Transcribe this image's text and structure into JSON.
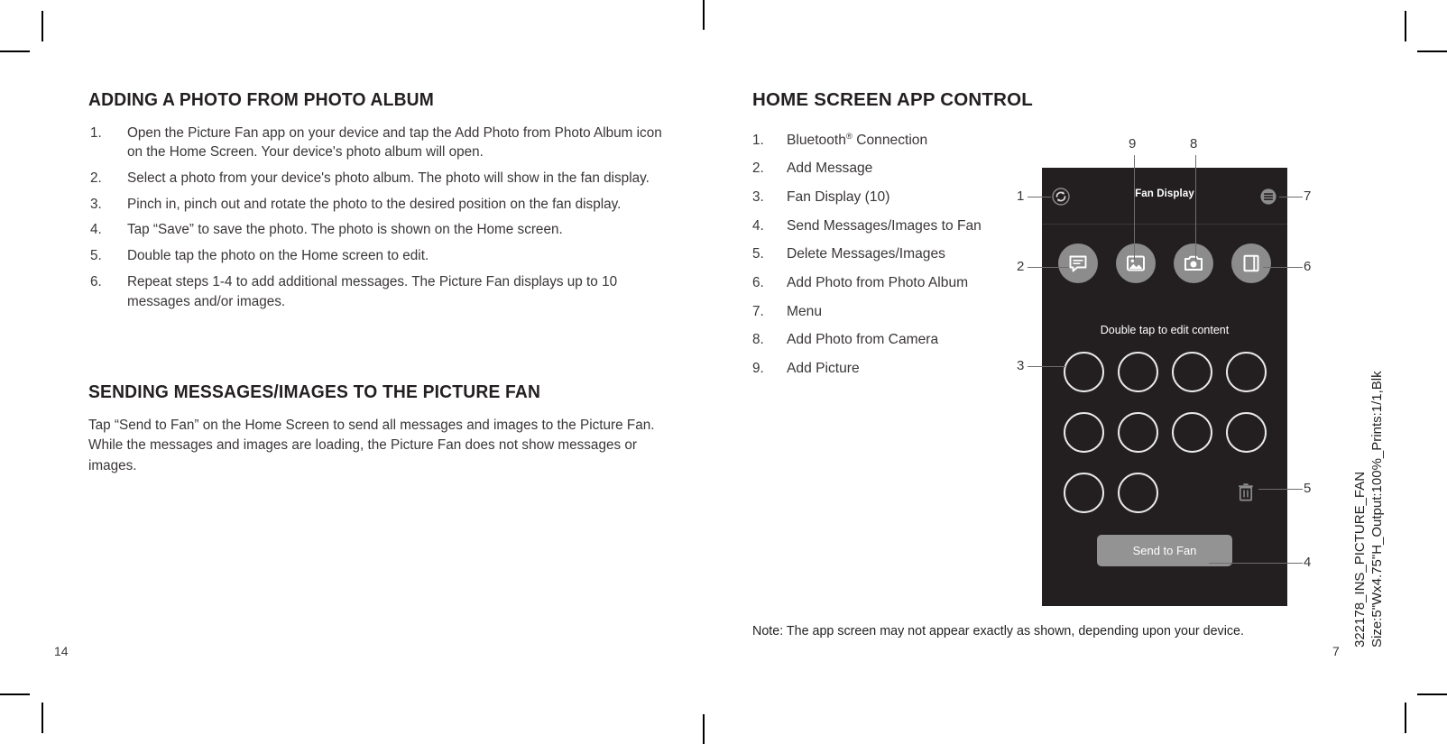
{
  "document": {
    "left_page_number": "14",
    "right_page_number": "7",
    "print_spec_line1": "322178_INS_PICTURE_FAN",
    "print_spec_line2": "Size:5\"Wx4.75\"H_Output:100%_Prints:1/1,Blk"
  },
  "left_column": {
    "section1": {
      "title": "ADDING A PHOTO FROM PHOTO ALBUM",
      "steps": [
        {
          "num": "1.",
          "text": "Open the Picture Fan app on your device and tap the Add Photo from Photo Album icon on the Home Screen. Your device's photo album will open."
        },
        {
          "num": "2.",
          "text": "Select a photo from your device's photo album. The photo will show in the fan display."
        },
        {
          "num": "3.",
          "text": "Pinch in, pinch out and rotate the photo to the desired position on the fan display."
        },
        {
          "num": "4.",
          "text": "Tap “Save” to save the photo. The photo is shown on the Home screen."
        },
        {
          "num": "5.",
          "text": "Double tap the photo on the Home screen to edit."
        },
        {
          "num": "6.",
          "text": "Repeat steps 1-4 to add additional messages. The Picture Fan displays up to 10 messages and/or images."
        }
      ]
    },
    "section2": {
      "title": "SENDING MESSAGES/IMAGES TO THE PICTURE FAN",
      "body": "Tap “Send to Fan” on the Home Screen to send all messages and images to the Picture Fan. While the messages and images are loading, the Picture Fan does not show messages or images."
    }
  },
  "right_column": {
    "title": "HOME SCREEN APP CONTROL",
    "legend": [
      {
        "num": "1.",
        "text": "Bluetooth",
        "sup": "®",
        "text_after": " Connection"
      },
      {
        "num": "2.",
        "text": "Add Message"
      },
      {
        "num": "3.",
        "text": "Fan Display (10)"
      },
      {
        "num": "4.",
        "text": "Send Messages/Images to Fan"
      },
      {
        "num": "5.",
        "text": "Delete Messages/Images"
      },
      {
        "num": "6.",
        "text": "Add Photo from Photo Album"
      },
      {
        "num": "7.",
        "text": "Menu"
      },
      {
        "num": "8.",
        "text": "Add Photo from Camera"
      },
      {
        "num": "9.",
        "text": "Add Picture"
      }
    ],
    "note": "Note: The app screen may not appear exactly as shown, depending upon your device."
  },
  "phone_mock": {
    "screen_title": "Fan Display",
    "hint_text": "Double tap to edit content",
    "send_button_label": "Send to Fan",
    "icons": {
      "refresh": "bluetooth-refresh-icon",
      "menu": "menu-icon",
      "message": "add-message-icon",
      "picture": "add-picture-icon",
      "camera": "add-photo-camera-icon",
      "album": "add-photo-album-icon",
      "trash": "delete-icon"
    },
    "fan_slots_total": 10,
    "colors": {
      "screen_bg": "#231f20",
      "button_gray": "#8c8c8c",
      "send_button": "#939393",
      "ring": "#e9e9e9",
      "text": "#ffffff"
    },
    "callouts": [
      {
        "label": "1",
        "target": "bluetooth-refresh-icon"
      },
      {
        "label": "2",
        "target": "add-message-icon"
      },
      {
        "label": "3",
        "target": "fan-display-slot"
      },
      {
        "label": "4",
        "target": "send-to-fan-button"
      },
      {
        "label": "5",
        "target": "delete-icon"
      },
      {
        "label": "6",
        "target": "add-photo-album-icon"
      },
      {
        "label": "7",
        "target": "menu-icon"
      },
      {
        "label": "8",
        "target": "add-photo-camera-icon"
      },
      {
        "label": "9",
        "target": "add-picture-icon"
      }
    ]
  }
}
